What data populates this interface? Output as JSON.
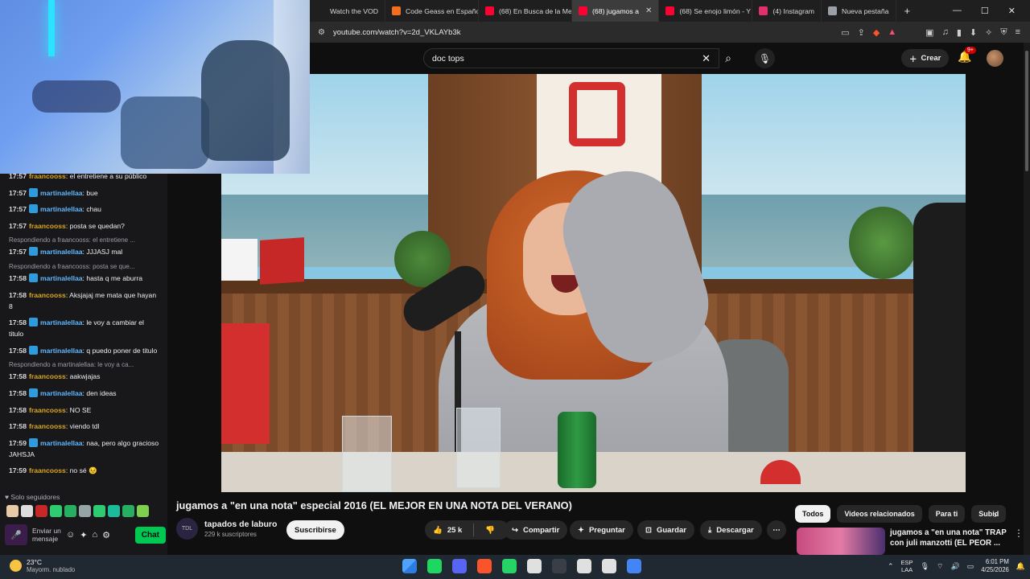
{
  "browser": {
    "tabs": [
      {
        "label": "Watch the VOD",
        "color": "#1f1f1f",
        "active": false
      },
      {
        "label": "Code Geass en Español",
        "color": "#f46e1e",
        "active": false
      },
      {
        "label": "(68) En Busca de la Mej",
        "color": "#ff0033",
        "active": false
      },
      {
        "label": "(68) jugamos a",
        "color": "#ff0033",
        "active": true
      },
      {
        "label": "(68) Se enojo limón - Y",
        "color": "#ff0033",
        "active": false
      },
      {
        "label": "(4) Instagram",
        "color": "#e1306c",
        "active": false
      },
      {
        "label": "Nueva pestaña",
        "color": "#9aa0a6",
        "active": false
      }
    ],
    "url": "youtube.com/watch?v=2d_VKLAYb3k"
  },
  "stream_chat": {
    "messages": [
      {
        "time": "17:57",
        "user": "fraancooss",
        "kind": "f",
        "text": "el entretiene a su público",
        "reply": ""
      },
      {
        "time": "17:57",
        "user": "martinalellaa",
        "kind": "m",
        "text": "bue",
        "reply": ""
      },
      {
        "time": "17:57",
        "user": "martinalellaa",
        "kind": "m",
        "text": "chau",
        "reply": ""
      },
      {
        "time": "17:57",
        "user": "fraancooss",
        "kind": "f",
        "text": "posta se quedan?",
        "reply": ""
      },
      {
        "time": "17:57",
        "user": "martinalellaa",
        "kind": "m",
        "text": "JJJASJ mal",
        "reply": "Respondiendo a fraancooss: el entretiene ..."
      },
      {
        "time": "17:58",
        "user": "martinalellaa",
        "kind": "m",
        "text": "hasta q me aburra",
        "reply": "Respondiendo a fraancooss: posta se que..."
      },
      {
        "time": "17:58",
        "user": "fraancooss",
        "kind": "f",
        "text": "Aksjajaj me mata que hayan 8",
        "reply": ""
      },
      {
        "time": "17:58",
        "user": "martinalellaa",
        "kind": "m",
        "text": "le voy a cambiar el titulo",
        "reply": ""
      },
      {
        "time": "17:58",
        "user": "martinalellaa",
        "kind": "m",
        "text": "q puedo poner de titulo",
        "reply": ""
      },
      {
        "time": "17:58",
        "user": "fraancooss",
        "kind": "f",
        "text": "aakwjajas",
        "reply": "Respondiendo a martinalellaa: le voy a ca..."
      },
      {
        "time": "17:58",
        "user": "martinalellaa",
        "kind": "m",
        "text": "den ideas",
        "reply": ""
      },
      {
        "time": "17:58",
        "user": "fraancooss",
        "kind": "f",
        "text": "NO SE",
        "reply": ""
      },
      {
        "time": "17:58",
        "user": "fraancooss",
        "kind": "f",
        "text": "viendo tdl",
        "reply": ""
      },
      {
        "time": "17:59",
        "user": "martinalellaa",
        "kind": "m",
        "text": "naa, pero algo gracioso JAHSJA",
        "reply": ""
      },
      {
        "time": "17:59",
        "user": "fraancooss",
        "kind": "f",
        "text": "no sé 😣",
        "reply": ""
      }
    ],
    "followers_only": "Solo seguidores",
    "send_placeholder": "Enviar un mensaje",
    "chat_button": "Chat"
  },
  "youtube": {
    "search_query": "doc tops",
    "create_label": "Crear",
    "notif_count": "9+",
    "video_title": "jugamos a \"en una nota\" especial 2016 (EL MEJOR EN UNA NOTA DEL VERANO)",
    "channel_name": "tapados de laburo",
    "channel_subs": "229 k suscriptores",
    "subscribe_label": "Suscribirse",
    "likes": "25 k",
    "share_label": "Compartir",
    "ask_label": "Preguntar",
    "save_label": "Guardar",
    "download_label": "Descargar",
    "chips": [
      "Todos",
      "Videos relacionados",
      "Para ti",
      "Subid"
    ],
    "related_title": "jugamos a \"en una nota\" TRAP con juli manzotti (EL PEOR ..."
  },
  "taskbar": {
    "temperature": "23°C",
    "condition": "Mayorm. nublado",
    "lang_top": "ESP",
    "lang_bottom": "LAA",
    "time": "6:01 PM",
    "date": "4/25/2026",
    "app_colors": [
      "#4fa3ff",
      "#1ed760",
      "#5865f2",
      "#fb542b",
      "#25d366",
      "#e0e0e0",
      "#3a3f47",
      "#e0e0e0",
      "#e0e0e0",
      "#4285f4"
    ]
  }
}
